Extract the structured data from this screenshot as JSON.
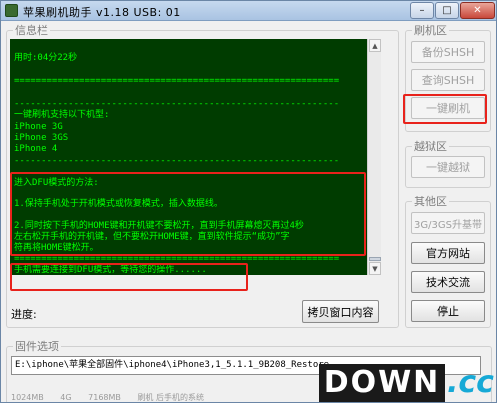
{
  "window": {
    "title": "苹果刷机助手 v1.18    USB: 01",
    "controls": {
      "minimize": "–",
      "maximize": "□",
      "close": "✕"
    }
  },
  "info_panel": {
    "legend": "信息栏",
    "console_lines": [
      "用时:04分22秒",
      "============================================================",
      "------------------------------------------------------------",
      "一键刷机支持以下机型:",
      "iPhone 3G",
      "iPhone 3GS",
      "iPhone 4",
      "------------------------------------------------------------",
      "进入DFU模式的方法:",
      "1.保持手机处于开机模式或恢复模式，插入数据线。",
      "2.同时按下手机的HOME键和开机键不要松开，直到手机屏幕熄灭再过4秒",
      "左右松开手机的开机键，但不要松开HOME键，直到软件提示“成功”字",
      "符再将HOME键松开。",
      "============================================================",
      "手机需要连接到DFU模式，等待您的操作......"
    ],
    "progress_label": "进度:",
    "copy_button": "拷贝窗口内容"
  },
  "flash_panel": {
    "legend": "刷机区",
    "backup_shsh": "备份SHSH",
    "query_shsh": "查询SHSH",
    "one_click_flash": "一键刷机"
  },
  "jailbreak_panel": {
    "legend": "越狱区",
    "one_click_jailbreak": "一键越狱"
  },
  "other_panel": {
    "legend": "其他区",
    "baseband_upgrade": "3G/3GS升基带",
    "official_site": "官方网站",
    "tech_exchange": "技术交流",
    "stop": "停止"
  },
  "firmware_panel": {
    "legend": "固件选项",
    "path": "E:\\iphone\\苹果全部固件\\iphone4\\iPhone3,1_5.1.1_9B208_Restore",
    "status_fragments": [
      "1024MB",
      "4G",
      "7168MB",
      "刷机 后手机的系统"
    ]
  },
  "watermark": {
    "left": "DOWN",
    "right": ".cc"
  },
  "colors": {
    "console_bg": "#003c00",
    "console_text": "#00ff00",
    "highlight_red": "#e8221b"
  }
}
